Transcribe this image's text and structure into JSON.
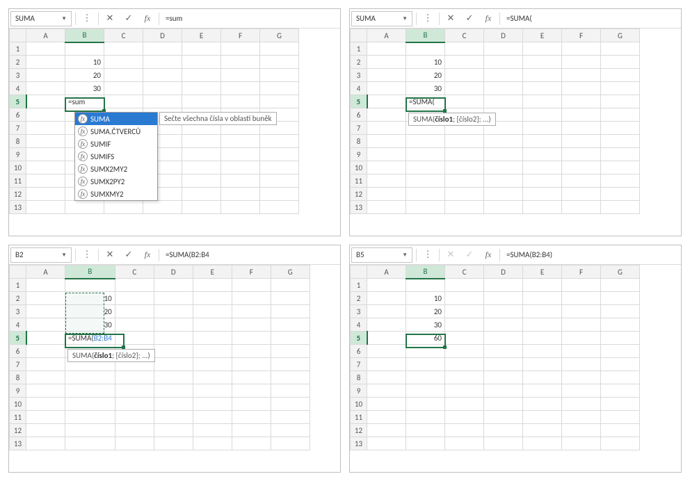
{
  "columns": [
    "A",
    "B",
    "C",
    "D",
    "E",
    "F",
    "G"
  ],
  "rows": [
    "1",
    "2",
    "3",
    "4",
    "5",
    "6",
    "7",
    "8",
    "9",
    "10",
    "11",
    "12",
    "13"
  ],
  "panels": {
    "p1": {
      "namebox": "SUMA",
      "formula_bar": "=sum",
      "activeCol": "B",
      "activeRow": "5",
      "cells": {
        "B2": "10",
        "B3": "20",
        "B4": "30",
        "B5": "=sum"
      },
      "autocomplete": {
        "items": [
          "SUMA",
          "SUMA.ČTVERCŮ",
          "SUMIF",
          "SUMIFS",
          "SUMX2MY2",
          "SUMX2PY2",
          "SUMXMY2"
        ],
        "selected": 0,
        "desc": "Sečte všechna čísla v oblasti buněk"
      }
    },
    "p2": {
      "namebox": "SUMA",
      "formula_bar": "=SUMA(",
      "activeCol": "B",
      "activeRow": "5",
      "cells": {
        "B2": "10",
        "B3": "20",
        "B4": "30",
        "B5": "=SUMA("
      },
      "hint_prefix": "SUMA(",
      "hint_bold": "číslo1",
      "hint_suffix": "; [číslo2]; ...)"
    },
    "p3": {
      "namebox": "B2",
      "formula_bar": "=SUMA(B2:B4",
      "activeCol": "B",
      "activeRow": "5",
      "cells": {
        "B2": "10",
        "B3": "20",
        "B4": "30"
      },
      "b5_prefix": "=SUMA(",
      "b5_range": "B2:B4",
      "hint_prefix": "SUMA(",
      "hint_bold": "číslo1",
      "hint_suffix": "; [číslo2]; ...)"
    },
    "p4": {
      "namebox": "B5",
      "formula_bar": "=SUMA(B2:B4)",
      "activeCol": "B",
      "activeRow": "5",
      "cells": {
        "B2": "10",
        "B3": "20",
        "B4": "30",
        "B5": "60"
      }
    }
  }
}
